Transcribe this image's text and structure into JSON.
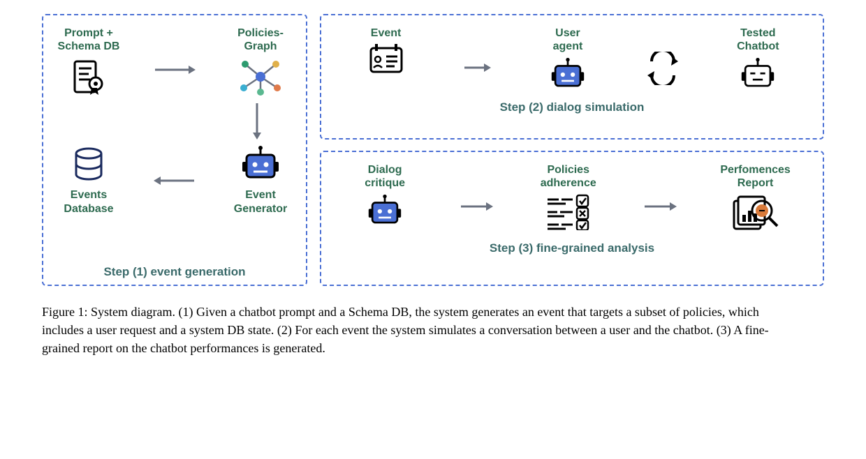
{
  "panel1": {
    "node1_l1": "Prompt +",
    "node1_l2": "Schema DB",
    "node2_l1": "Policies-",
    "node2_l2": "Graph",
    "node3_l1": "Events",
    "node3_l2": "Database",
    "node4_l1": "Event",
    "node4_l2": "Generator",
    "caption": "Step (1) event generation"
  },
  "panel2": {
    "node1": "Event",
    "node2_l1": "User",
    "node2_l2": "agent",
    "node3_l1": "Tested",
    "node3_l2": "Chatbot",
    "caption": "Step (2) dialog simulation"
  },
  "panel3": {
    "node1_l1": "Dialog",
    "node1_l2": "critique",
    "node2_l1": "Policies",
    "node2_l2": "adherence",
    "node3_l1": "Perfomences",
    "node3_l2": "Report",
    "caption": "Step (3) fine-grained analysis"
  },
  "figure_caption": "Figure 1: System diagram. (1) Given a chatbot prompt and a Schema DB, the system generates an event that targets a subset of policies, which includes a user request and a system DB state. (2) For each event the system simulates a conversation between a user and the chatbot. (3) A fine-grained report on the chatbot performances is generated."
}
